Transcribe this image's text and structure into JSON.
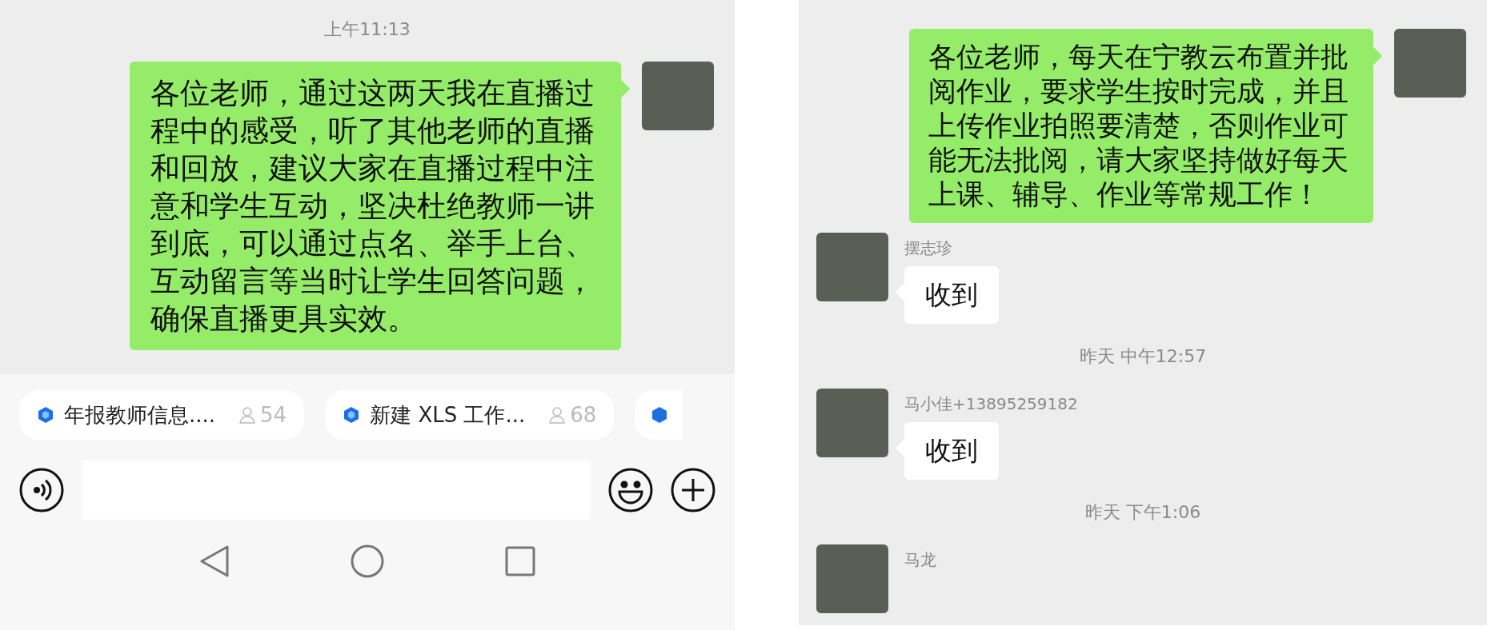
{
  "left_screen": {
    "messages": [
      {
        "kind": "time",
        "text": "上午11:13"
      },
      {
        "kind": "outgoing",
        "text": "各位老师，通过这两天我在直播过程中的感受，听了其他老师的直播和回放，建议大家在直播过程中注意和学生互动，坚决杜绝教师一讲到底，可以通过点名、举手上台、互动留言等当时让学生回答问题，确保直播更具实效。"
      }
    ],
    "shortcuts": [
      {
        "label": "年报教师信息....",
        "count": "54"
      },
      {
        "label": "新建 XLS 工作...",
        "count": "68"
      }
    ]
  },
  "right_screen": {
    "messages": [
      {
        "kind": "outgoing",
        "text": "各位老师，每天在宁教云布置并批阅作业，要求学生按时完成，并且上传作业拍照要清楚，否则作业可能无法批阅，请大家坚持做好每天上课、辅导、作业等常规工作！"
      },
      {
        "kind": "incoming",
        "sender": "摆志珍",
        "text": "收到"
      },
      {
        "kind": "time",
        "text": "昨天 中午12:57"
      },
      {
        "kind": "incoming",
        "sender": "马小佳+13895259182",
        "text": "收到"
      },
      {
        "kind": "time",
        "text": "昨天 下午1:06"
      },
      {
        "kind": "incoming",
        "sender": "马龙"
      }
    ]
  }
}
